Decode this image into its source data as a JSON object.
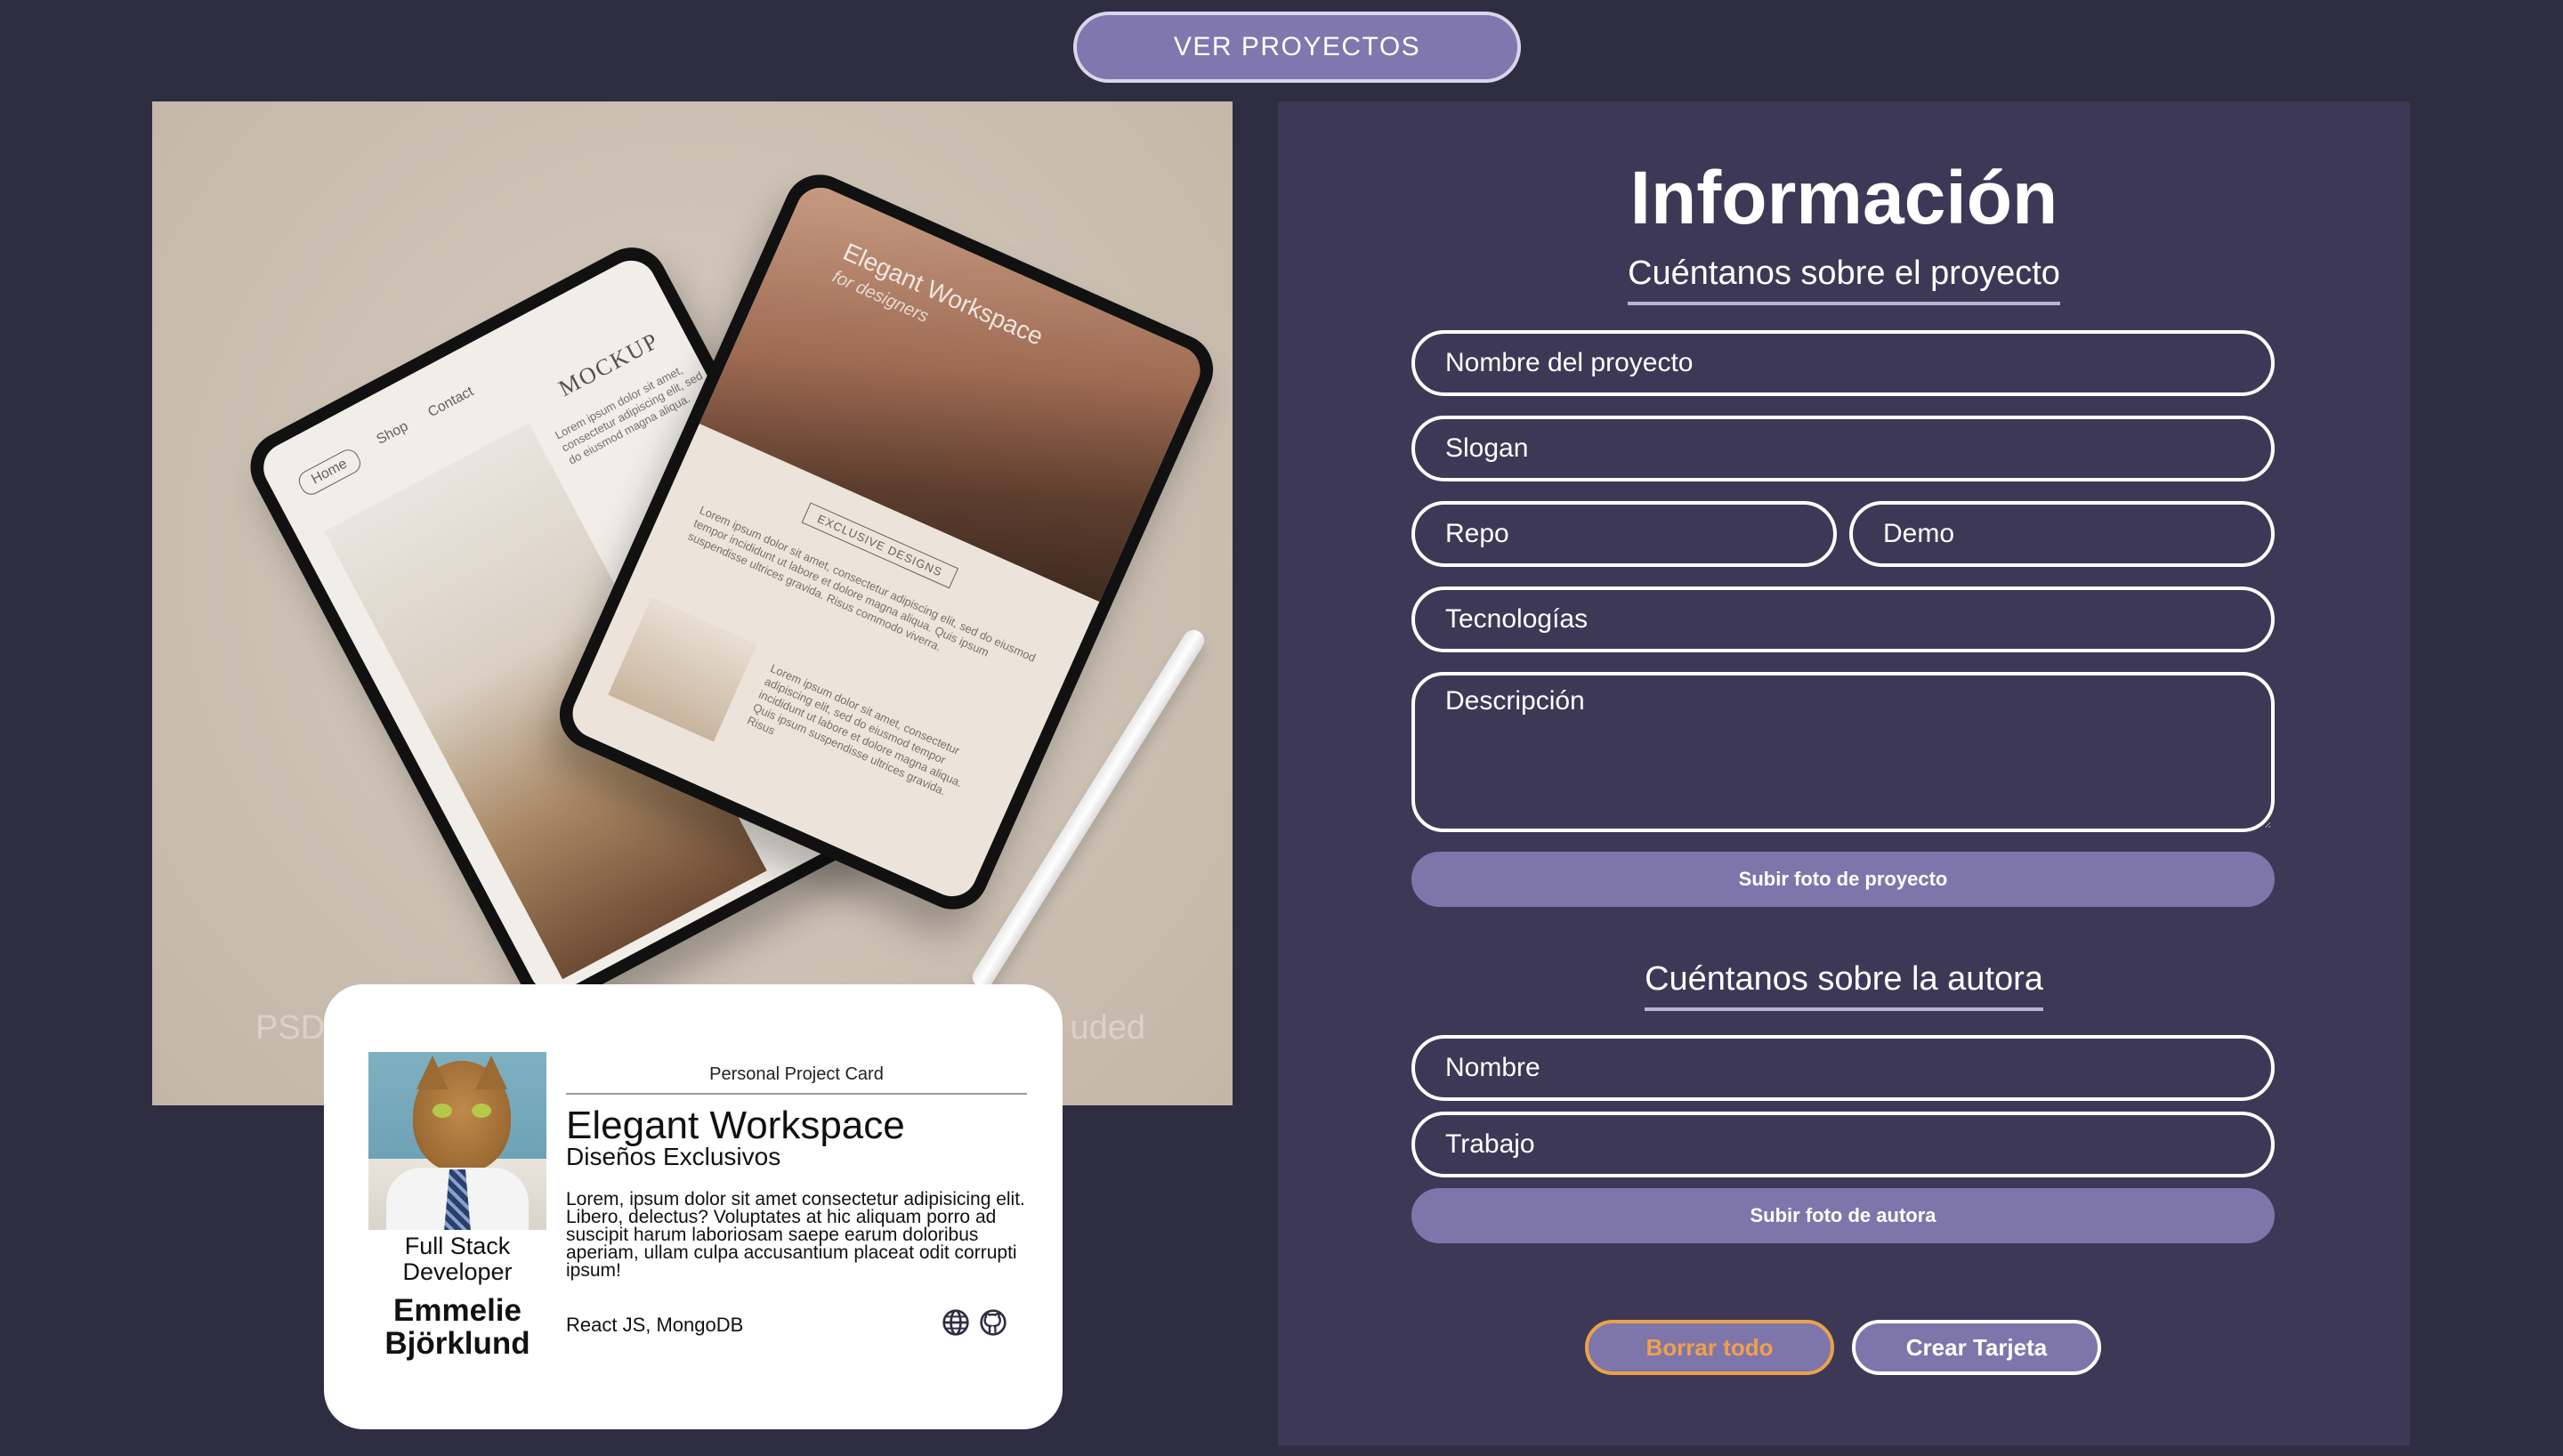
{
  "top_button": {
    "label": "VER PROYECTOS"
  },
  "mockup": {
    "watermark_left": "PSD",
    "watermark_right": "uded",
    "back_tablet": {
      "nav": [
        "Home",
        "Shop",
        "Contact"
      ],
      "title": "MOCKUP",
      "lorem": "Lorem ipsum dolor sit amet, consectetur adipiscing elit, sed do eiusmod magna aliqua."
    },
    "front_tablet": {
      "photo_title": "Elegant Workspace",
      "photo_sub": "for designers",
      "badge": "EXCLUSIVE DESIGNS",
      "lorem1": "Lorem ipsum dolor sit amet, consectetur adipiscing elit, sed do eiusmod tempor incididunt ut labore et dolore magna aliqua. Quis ipsum suspendisse ultrices gravida. Risus commodo viverra.",
      "lorem2": "Lorem ipsum dolor sit amet, consectetur adipiscing elit, sed do eiusmod tempor incididunt ut labore et dolore magna aliqua. Quis ipsum suspendisse ultrices gravida. Risus"
    }
  },
  "card": {
    "label": "Personal Project Card",
    "project_name": "Elegant Workspace",
    "slogan": "Diseños Exclusivos",
    "description": "Lorem, ipsum dolor sit amet consectetur adipisicing elit. Libero, delectus? Voluptates at hic aliquam porro ad suscipit harum laboriosam saepe earum doloribus aperiam, ullam culpa accusantium placeat odit corrupti ipsum!",
    "technologies": "React JS, MongoDB",
    "job": "Full Stack Developer",
    "author": "Emmelie Björklund",
    "icons": [
      "globe-icon",
      "github-icon"
    ]
  },
  "form": {
    "title": "Información",
    "project_section": "Cuéntanos sobre el proyecto",
    "placeholders": {
      "name": "Nombre del proyecto",
      "slogan": "Slogan",
      "repo": "Repo",
      "demo": "Demo",
      "technologies": "Tecnologías",
      "description": "Descripción",
      "author_name": "Nombre",
      "job": "Trabajo"
    },
    "upload_project": "Subir foto de proyecto",
    "author_section": "Cuéntanos sobre la autora",
    "upload_author": "Subir foto de autora",
    "reset": "Borrar todo",
    "create": "Crear Tarjeta"
  },
  "colors": {
    "background": "#2f2d42",
    "panel": "#3e3857",
    "accent": "#7e76ab",
    "reset_border": "#eaa24a"
  }
}
